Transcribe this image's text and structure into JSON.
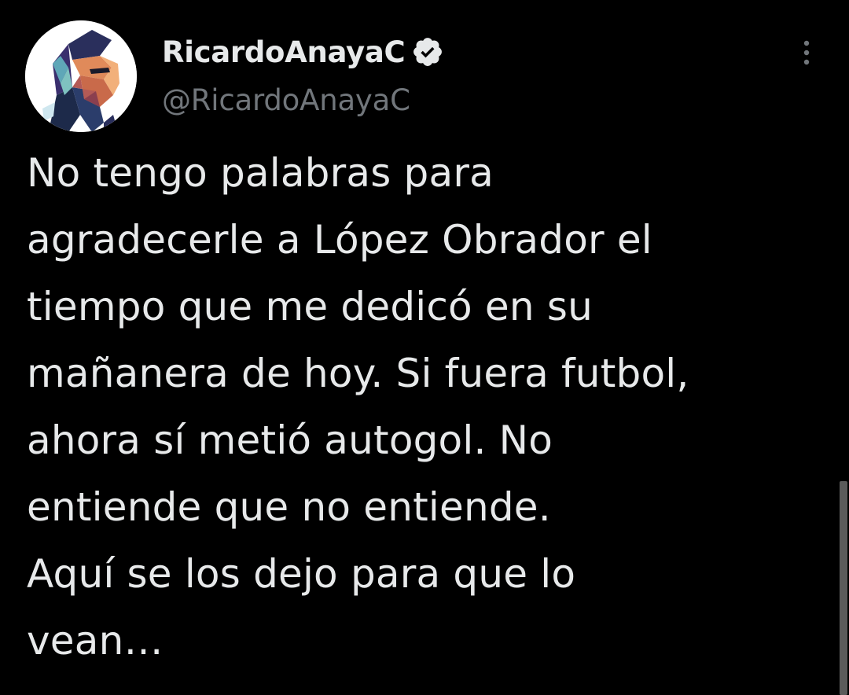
{
  "tweet": {
    "display_name": "RicardoAnayaC",
    "handle": "@RicardoAnayaC",
    "verified": true,
    "verified_icon": "verified-badge-icon",
    "more_icon": "more-vertical-icon",
    "text_lines": [
      "No tengo palabras para",
      "agradecerle a López Obrador el",
      "tiempo que me dedicó en su",
      "mañanera de hoy. Si fuera futbol,",
      "ahora sí metió autogol. No",
      "entiende que no entiende.",
      "Aquí se los dejo para que lo",
      "vean…"
    ]
  },
  "colors": {
    "background": "#000000",
    "text_primary": "#e7e9ea",
    "text_secondary": "#71767b",
    "avatar_bg": "#ffffff"
  }
}
